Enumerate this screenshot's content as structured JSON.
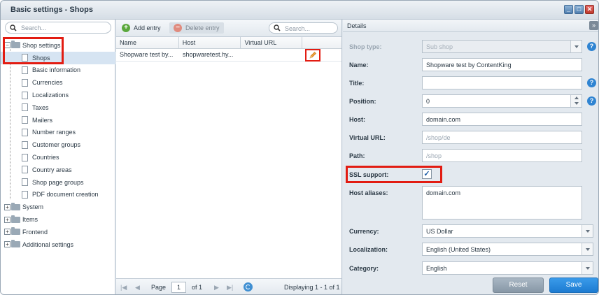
{
  "window": {
    "title": "Basic settings - Shops",
    "controls": [
      "_",
      "□",
      "✕"
    ]
  },
  "tree": {
    "search_placeholder": "Search...",
    "root": {
      "label": "Shop settings",
      "expand": "−"
    },
    "children": [
      {
        "label": "Shops"
      },
      {
        "label": "Basic information"
      },
      {
        "label": "Currencies"
      },
      {
        "label": "Localizations"
      },
      {
        "label": "Taxes"
      },
      {
        "label": "Mailers"
      },
      {
        "label": "Number ranges"
      },
      {
        "label": "Customer groups"
      },
      {
        "label": "Countries"
      },
      {
        "label": "Country areas"
      },
      {
        "label": "Shop page groups"
      },
      {
        "label": "PDF document creation"
      }
    ],
    "others": [
      {
        "label": "System",
        "expand": "+"
      },
      {
        "label": "Items",
        "expand": "+"
      },
      {
        "label": "Frontend",
        "expand": "+"
      },
      {
        "label": "Additional settings",
        "expand": "+"
      }
    ]
  },
  "grid": {
    "add_label": "Add entry",
    "delete_label": "Delete entry",
    "search_placeholder": "Search...",
    "columns": [
      "Name",
      "Host",
      "Virtual URL"
    ],
    "rows": [
      {
        "name": "Shopware test by...",
        "host": "shopwaretest.hy...",
        "virtual_url": ""
      }
    ],
    "pager": {
      "page_label": "Page",
      "page_value": "1",
      "of_label": "of 1",
      "display": "Displaying 1 - 1 of 1"
    }
  },
  "details": {
    "header": "Details",
    "collapse": "»",
    "shop_type": {
      "label": "Shop type:",
      "value": "Sub shop"
    },
    "name": {
      "label": "Name:",
      "value": "Shopware test by ContentKing"
    },
    "title": {
      "label": "Title:",
      "value": ""
    },
    "position": {
      "label": "Position:",
      "value": "0"
    },
    "host": {
      "label": "Host:",
      "value": "domain.com"
    },
    "virtual_url": {
      "label": "Virtual URL:",
      "placeholder": "/shop/de"
    },
    "path": {
      "label": "Path:",
      "placeholder": "/shop"
    },
    "ssl": {
      "label": "SSL support:",
      "checked_glyph": "✓"
    },
    "host_aliases": {
      "label": "Host aliases:",
      "value": "domain.com"
    },
    "currency": {
      "label": "Currency:",
      "value": "US Dollar"
    },
    "localization": {
      "label": "Localization:",
      "value": "English (United States)"
    },
    "category": {
      "label": "Category:",
      "value": "English"
    },
    "help_glyph": "?",
    "reset_label": "Reset",
    "save_label": "Save"
  }
}
